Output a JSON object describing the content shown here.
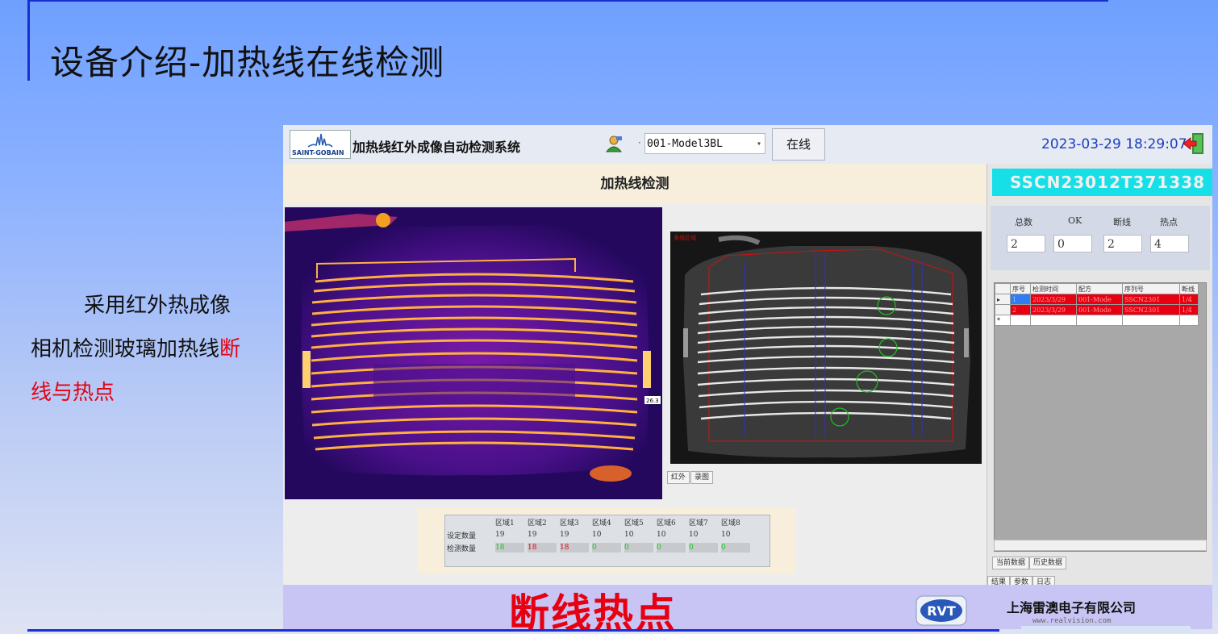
{
  "slide": {
    "title": "设备介绍-加热线在线检测",
    "description_part1": "采用红外热成像相机检测玻璃加热线",
    "description_highlight": "断线与热点"
  },
  "app": {
    "logo_text": "SAINT-GOBAIN",
    "title": "加热线红外成像自动检测系统",
    "model_selected": "001-Model3BL",
    "online_label": "在线",
    "datetime": "2023-03-29 18:29:07",
    "section_title": "加热线检测",
    "image_tabs": [
      "红外",
      "录图"
    ],
    "overlay_label": "多线区域",
    "temp_tag": "26.3",
    "zones": {
      "headers": [
        "区域1",
        "区域2",
        "区域3",
        "区域4",
        "区域5",
        "区域6",
        "区域7",
        "区域8"
      ],
      "set_label": "设定数量",
      "detect_label": "检测数量",
      "set_values": [
        "19",
        "19",
        "19",
        "10",
        "10",
        "10",
        "10",
        "10"
      ],
      "detect_values": [
        "18",
        "18",
        "18",
        "0",
        "0",
        "0",
        "0",
        "0"
      ]
    },
    "banner": "断线热点",
    "serial": "SSCN23012T371338",
    "stats": {
      "labels": [
        "总数",
        "OK",
        "断线",
        "热点"
      ],
      "values": [
        "2",
        "0",
        "2",
        "4"
      ]
    },
    "grid": {
      "headers": [
        "序号",
        "检测时间",
        "配方",
        "序列号",
        "断线"
      ],
      "rows": [
        [
          "1",
          "2023/3/29",
          "001-Mode",
          "SSCN2301",
          "1/4"
        ],
        [
          "2",
          "2023/3/29",
          "001-Mode",
          "SSCN2301",
          "1/4"
        ]
      ]
    },
    "data_tabs": [
      "当前数据",
      "历史数据"
    ],
    "bottom_tabs": [
      "结果",
      "参数",
      "日志"
    ]
  },
  "footer": {
    "rvt_logo": "RVT",
    "company": "上海雷澳电子有限公司",
    "website": "www.realvision.com"
  },
  "colors": {
    "accent_blue": "#1a2fd0",
    "alarm_red": "#e60012",
    "serial_cyan": "#16dfe8"
  }
}
